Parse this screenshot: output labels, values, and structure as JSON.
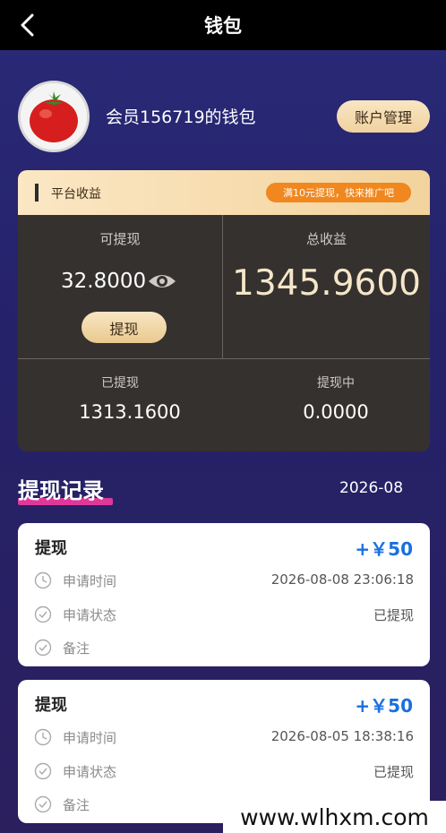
{
  "header": {
    "title": "钱包"
  },
  "profile": {
    "member_name": "会员156719的钱包",
    "account_button": "账户管理"
  },
  "wallet": {
    "section_title": "平台收益",
    "promo": "满10元提现，快来推广吧",
    "withdrawable_label": "可提现",
    "withdrawable_value": "32.8000",
    "withdraw_button": "提现",
    "total_label": "总收益",
    "total_value": "1345.9600",
    "withdrawn_label": "已提现",
    "withdrawn_value": "1313.1600",
    "pending_label": "提现中",
    "pending_value": "0.0000"
  },
  "records": {
    "title": "提现记录",
    "month": "2026-08",
    "items": [
      {
        "type": "提现",
        "amount": "+￥50",
        "time_label": "申请时间",
        "time": "2026-08-08 23:06:18",
        "status_label": "申请状态",
        "status": "已提现",
        "note_label": "备注",
        "note": ""
      },
      {
        "type": "提现",
        "amount": "+￥50",
        "time_label": "申请时间",
        "time": "2026-08-05 18:38:16",
        "status_label": "申请状态",
        "status": "已提现",
        "note_label": "备注",
        "note": ""
      }
    ]
  },
  "watermark": "www.wlhxm.com",
  "colors": {
    "accent_gold": "#efd2a0",
    "promo_orange": "#f0871f",
    "amount_blue": "#1a6fe0",
    "underline_pink": "#e0379b"
  }
}
